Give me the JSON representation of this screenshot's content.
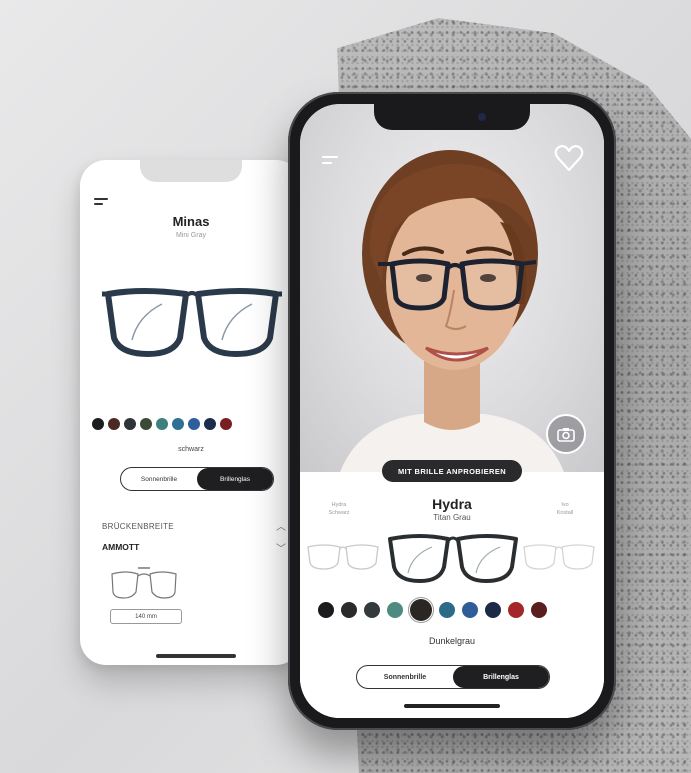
{
  "back_screen": {
    "title": "Minas",
    "subtitle": "Mini Gray",
    "color_name": "schwarz",
    "toggle": [
      "Sonnenbrille",
      "Brillenglas"
    ],
    "section_label": "BRÜCKENBREITE",
    "section_value": "AMMOTT",
    "measure_button": "140 mm",
    "color_swatches": [
      "#1d1d20",
      "#4a2a22",
      "#2f3436",
      "#3b4a36",
      "#3f7f7c",
      "#2f6f93",
      "#2e5f9c",
      "#1c2c4d",
      "#7a1e22"
    ]
  },
  "front_screen": {
    "try_on_label": "MIT BRILLE ANPROBIEREN",
    "model_name": "Hydra",
    "model_sub": "Titan Grau",
    "left_label": "Hydra",
    "left_sub": "Schwarz",
    "right_label": "Ivo",
    "right_sub": "Kristall",
    "color_name": "Dunkelgrau",
    "toggle": [
      "Sonnenbrille",
      "Brillenglas"
    ],
    "color_swatches": [
      "#1b1b1e",
      "#2b2b2e",
      "#333a3c",
      "#4f8a80",
      "#2a2624",
      "#2d6a88",
      "#2e5d97",
      "#1c2a48",
      "#a2262a",
      "#5a1e1e"
    ],
    "selected_swatch": 4
  }
}
